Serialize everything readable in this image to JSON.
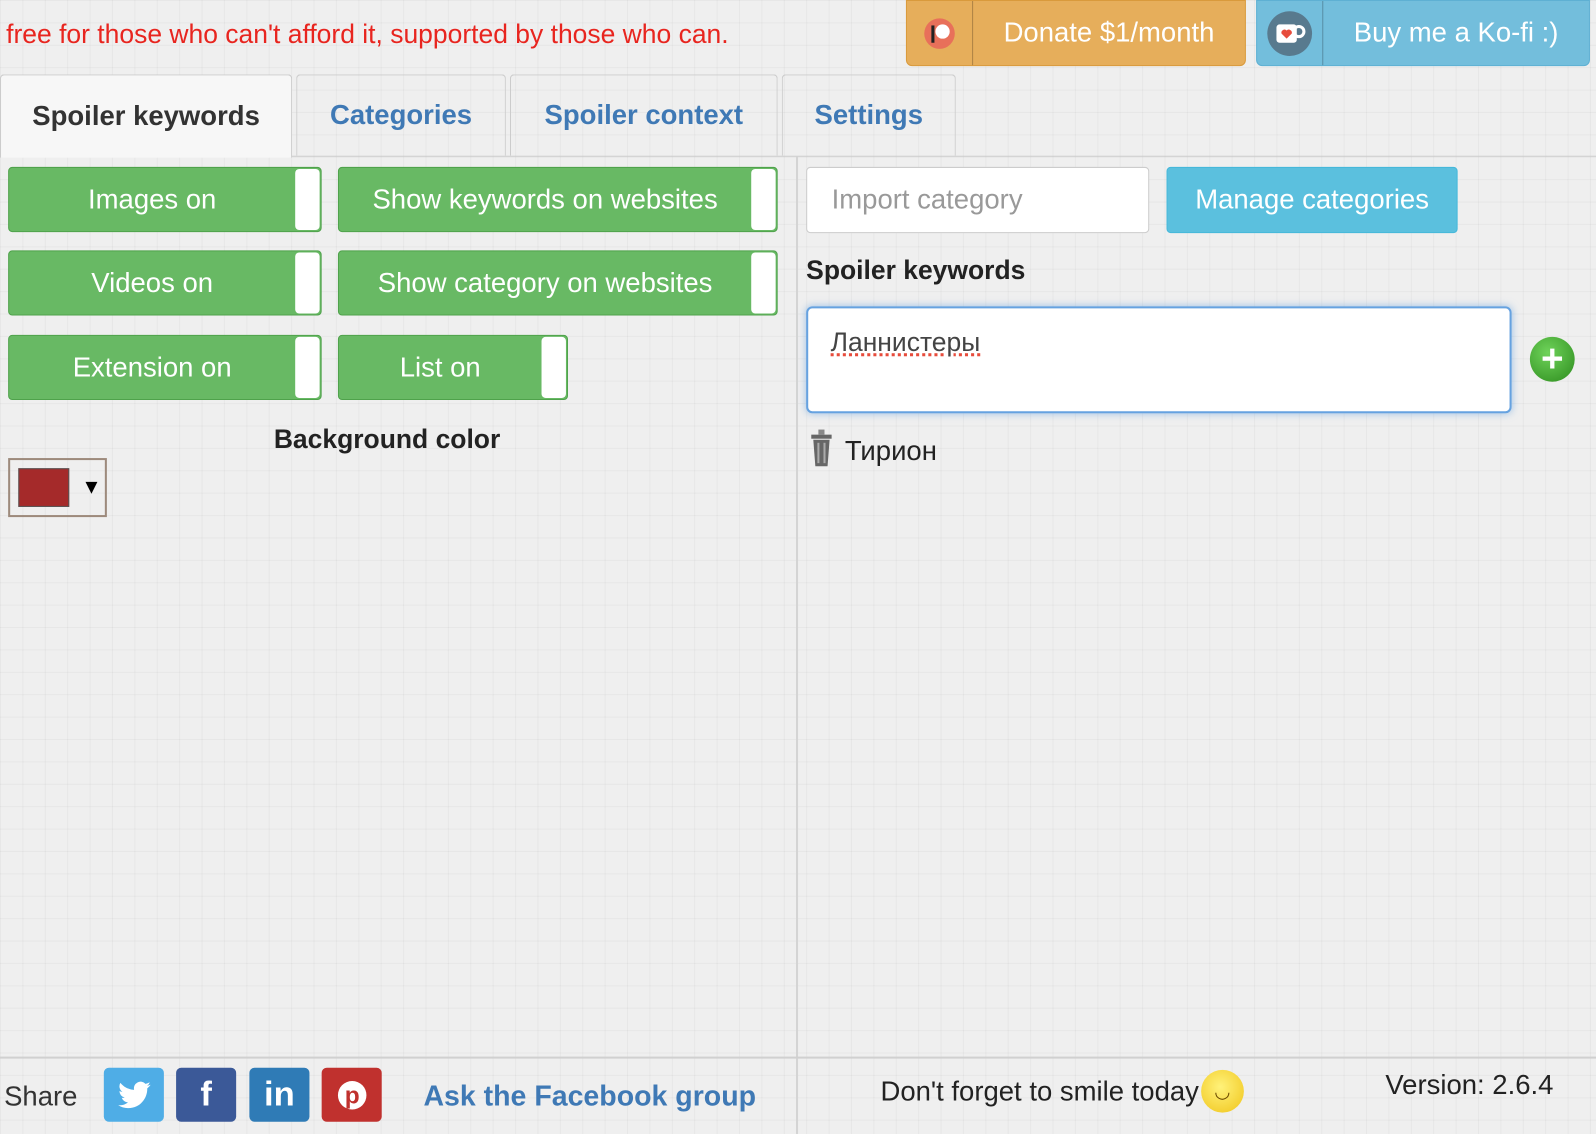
{
  "header": {
    "tagline": "free for those who can't afford it, supported by those who can.",
    "donate_label": "Donate $1/month",
    "donate_icon": "patreon-icon",
    "kofi_label": "Buy me a Ko-fi :)",
    "kofi_icon": "kofi-cup-icon"
  },
  "tabs": [
    {
      "label": "Spoiler keywords",
      "active": true
    },
    {
      "label": "Categories"
    },
    {
      "label": "Spoiler context"
    },
    {
      "label": "Settings"
    }
  ],
  "toggles": [
    {
      "label": "Images on",
      "on": true
    },
    {
      "label": "Show keywords on websites",
      "on": true
    },
    {
      "label": "Videos on",
      "on": true
    },
    {
      "label": "Show category on websites",
      "on": true
    },
    {
      "label": "Extension on",
      "on": true
    },
    {
      "label": "List on",
      "on": true
    }
  ],
  "background": {
    "label": "Background color",
    "color": "#a52a2a"
  },
  "right": {
    "import_placeholder": "Import category",
    "manage_label": "Manage categories",
    "keywords_label": "Spoiler keywords",
    "keyword_input": "Ланнистеры",
    "keywords": [
      "Тирион"
    ]
  },
  "footer": {
    "share_label": "Share",
    "facebook_group": "Ask the Facebook group",
    "smile": "Don't forget to smile today",
    "version": "Version: 2.6.4"
  },
  "colors": {
    "toggle_green": "#68b964",
    "accent_blue": "#3f79b5",
    "donate": "#e6ae5b",
    "kofi": "#73bedc",
    "tagline_red": "#e8251f"
  }
}
